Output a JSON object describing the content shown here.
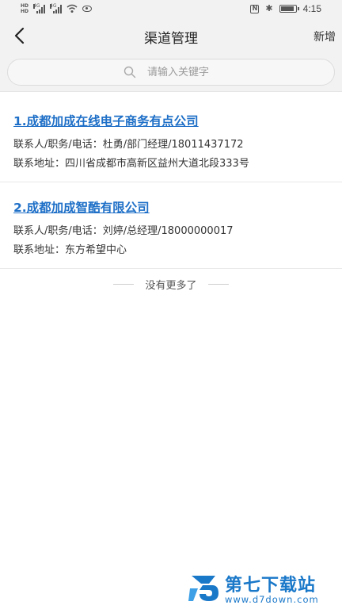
{
  "status_bar": {
    "time": "4:15",
    "hd_label": "HD",
    "net_labels": [
      "4G",
      "4G"
    ],
    "battery_level": 0.9,
    "icons": [
      "hd-icon",
      "signal-icon",
      "signal-icon",
      "wifi-icon",
      "eye-icon",
      "nfc-icon",
      "bluetooth-icon",
      "battery-icon"
    ]
  },
  "nav": {
    "back_icon": "chevron-left-icon",
    "title": "渠道管理",
    "add_label": "新增"
  },
  "search": {
    "placeholder": "请输入关键字",
    "value": "",
    "icon": "search-icon"
  },
  "channels": [
    {
      "title": "1.成都加成在线电子商务有点公司",
      "contact": "联系人/职务/电话：杜勇/部门经理/18011437172",
      "address": "联系地址：四川省成都市高新区益州大道北段333号"
    },
    {
      "title": "2.成都加成智酷有限公司",
      "contact": "联系人/职务/电话：刘婷/总经理/18000000017",
      "address": "联系地址：东方希望中心"
    }
  ],
  "footer": {
    "no_more": "没有更多了"
  },
  "watermark": {
    "name": "第七下载站",
    "url": "www.d7down.com",
    "color": "#1a78c9"
  },
  "colors": {
    "link": "#1e6fc7",
    "bar_bg": "#f2f2f2"
  }
}
